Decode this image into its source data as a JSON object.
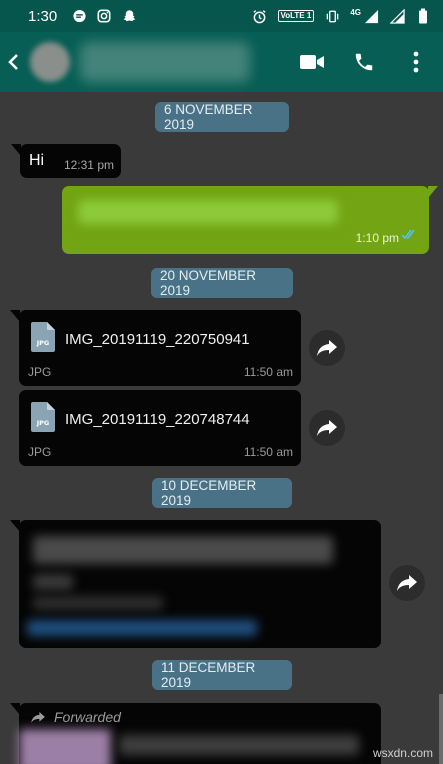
{
  "status_bar": {
    "time": "1:30",
    "network_label": "VoLTE 1",
    "network_type": "4G"
  },
  "app_bar": {
    "icons": [
      "back-arrow-icon",
      "video-call-icon",
      "phone-icon",
      "more-vert-icon"
    ]
  },
  "chat": {
    "dates": [
      "6 NOVEMBER 2019",
      "20 NOVEMBER 2019",
      "10 DECEMBER 2019",
      "11 DECEMBER 2019"
    ],
    "messages": [
      {
        "type": "text_in",
        "text": "Hi",
        "time": "12:31 pm"
      },
      {
        "type": "text_out",
        "time": "1:10 pm"
      },
      {
        "type": "document",
        "filename": "IMG_20191119_220750941",
        "filetype": "JPG",
        "time": "11:50 am"
      },
      {
        "type": "document",
        "filename": "IMG_20191119_220748744",
        "filetype": "JPG",
        "time": "11:50 am"
      },
      {
        "type": "link_in"
      },
      {
        "type": "forwarded",
        "label": "Forwarded"
      }
    ]
  },
  "colors": {
    "header": "#075e54",
    "outgoing_bubble": "#72a413",
    "incoming_bubble": "#050505",
    "date_pill": "#4a7287",
    "read_ticks": "#4fc3f7"
  },
  "watermark": "wsxdn.com"
}
